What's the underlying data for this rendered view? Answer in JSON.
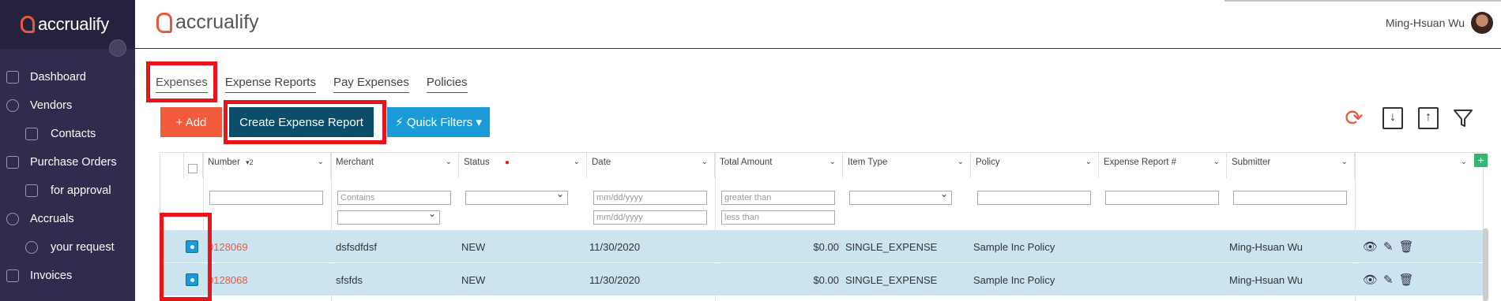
{
  "sidebar": {
    "brand": "accrualify",
    "items": [
      {
        "label": "Dashboard",
        "icon": "home-icon",
        "level": "top"
      },
      {
        "label": "Vendors",
        "icon": "users-icon",
        "level": "top"
      },
      {
        "label": "Contacts",
        "icon": "contact-card-icon",
        "level": "sub"
      },
      {
        "label": "Purchase Orders",
        "icon": "cart-icon",
        "level": "top"
      },
      {
        "label": "for approval",
        "icon": "stamp-icon",
        "level": "sub"
      },
      {
        "label": "Accruals",
        "icon": "coin-icon",
        "level": "top"
      },
      {
        "label": "your request",
        "icon": "target-icon",
        "level": "sub"
      },
      {
        "label": "Invoices",
        "icon": "invoice-icon",
        "level": "top"
      }
    ]
  },
  "header": {
    "brand": "accrualify",
    "user_name": "Ming-Hsuan Wu"
  },
  "tabs": [
    {
      "label": "Expenses",
      "active": true
    },
    {
      "label": "Expense Reports"
    },
    {
      "label": "Pay Expenses"
    },
    {
      "label": "Policies"
    }
  ],
  "toolbar": {
    "add_label": "+ Add",
    "create_label": "Create Expense Report",
    "quick_filters_label": "⚡ Quick Filters ▾"
  },
  "table": {
    "columns": [
      "Number",
      "Merchant",
      "Status",
      "Date",
      "Total Amount",
      "Item Type",
      "Policy",
      "Expense Report #",
      "Submitter"
    ],
    "sort_indicator": "▾2",
    "filters": {
      "merchant_placeholder": "Contains",
      "date_placeholder": "mm/dd/yyyy",
      "amount_gt_placeholder": "greater than",
      "amount_lt_placeholder": "less than"
    },
    "rows": [
      {
        "number": "0128069",
        "merchant": "dsfsdfdsf",
        "status": "NEW",
        "date": "11/30/2020",
        "total": "$0.00",
        "item_type": "SINGLE_EXPENSE",
        "policy": "Sample Inc Policy",
        "report": "",
        "submitter": "Ming-Hsuan Wu",
        "selected": true
      },
      {
        "number": "0128068",
        "merchant": "sfsfds",
        "status": "NEW",
        "date": "11/30/2020",
        "total": "$0.00",
        "item_type": "SINGLE_EXPENSE",
        "policy": "Sample Inc Policy",
        "report": "",
        "submitter": "Ming-Hsuan Wu",
        "selected": true
      }
    ]
  },
  "colors": {
    "sidebar_bg": "#2f2c4e",
    "accent_orange": "#f15a3a",
    "dark_teal": "#0b4e6a",
    "filter_blue": "#1a9bd7",
    "row_selected": "#cbe4f0",
    "highlight_red": "#e8141a"
  }
}
